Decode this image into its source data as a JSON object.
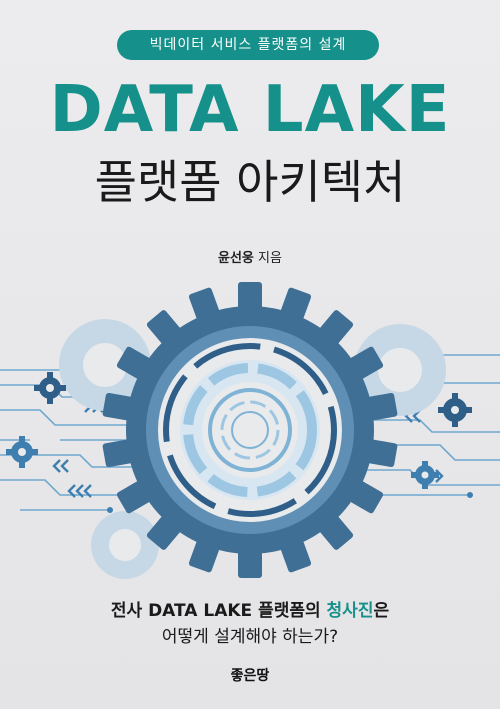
{
  "series": "빅데이터 서비스 플랫폼의 설계",
  "title": "DATA LAKE",
  "subtitle": "플랫폼 아키텍처",
  "author": {
    "name": "윤선웅",
    "role": "지음"
  },
  "tagline": {
    "line1_part1": "전사 DATA LAKE 플랫폼의 ",
    "line1_part2": "청사진",
    "line1_part3": "은",
    "line2": "어떻게 설계해야 하는가?"
  },
  "publisher": "좋은땅",
  "colors": {
    "accent": "#16908a",
    "gear_dark": "#3f6f95",
    "gear_light": "#9cc6e2",
    "background": "#e6e6e8"
  },
  "icons": [
    "large-gear-icon",
    "small-gear-icon",
    "circuit-lines",
    "chevron-arrows-icon"
  ]
}
